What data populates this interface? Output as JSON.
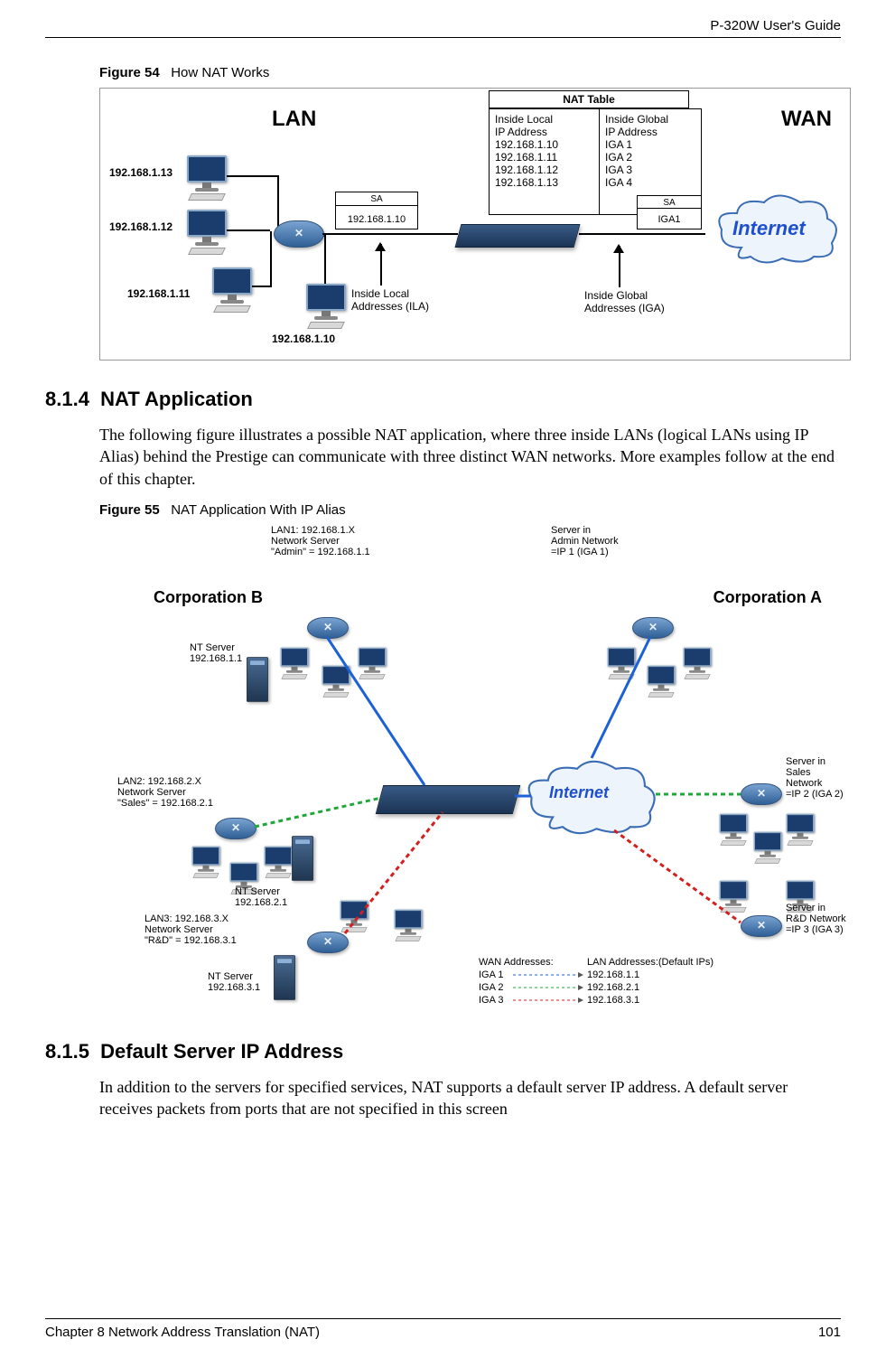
{
  "header": {
    "guide_title": "P-320W User's Guide"
  },
  "figure54": {
    "caption_label": "Figure 54",
    "caption_text": "How NAT Works",
    "lan_label": "LAN",
    "wan_label": "WAN",
    "internet_label": "Internet",
    "nat_table_title": "NAT Table",
    "col_local_header": "Inside Local\nIP Address",
    "col_global_header": "Inside Global\nIP Address",
    "local_ips": [
      "192.168.1.10",
      "192.168.1.11",
      "192.168.1.12",
      "192.168.1.13"
    ],
    "global_ips": [
      "IGA 1",
      "IGA 2",
      "IGA 3",
      "IGA 4"
    ],
    "pc_labels": [
      "192.168.1.13",
      "192.168.1.12",
      "192.168.1.11",
      "192.168.1.10"
    ],
    "env_left_sa": "SA",
    "env_left_addr": "192.168.1.10",
    "env_right_sa": "SA",
    "env_right_addr": "IGA1",
    "ila_label": "Inside Local\nAddresses (ILA)",
    "iga_label": "Inside Global\nAddresses (IGA)"
  },
  "section814": {
    "number": "8.1.4",
    "title": "NAT Application",
    "paragraph": "The following figure illustrates a possible NAT application, where three inside LANs (logical LANs using IP Alias) behind the Prestige can communicate with three distinct WAN networks. More examples follow at the end of this chapter."
  },
  "figure55": {
    "caption_label": "Figure 55",
    "caption_text": "NAT Application With IP Alias",
    "corp_a": "Corporation A",
    "corp_b": "Corporation B",
    "internet_label": "Internet",
    "lan1_text": "LAN1: 192.168.1.X\nNetwork Server\n\"Admin\" = 192.168.1.1",
    "lan2_text": "LAN2: 192.168.2.X\nNetwork Server\n\"Sales\" = 192.168.2.1",
    "lan3_text": "LAN3: 192.168.3.X\nNetwork Server\n\"R&D\" = 192.168.3.1",
    "nt1": "NT Server\n192.168.1.1",
    "nt2": "NT Server\n192.168.2.1",
    "nt3": "NT Server\n192.168.3.1",
    "srv_admin": "Server in\nAdmin Network\n=IP 1 (IGA 1)",
    "srv_sales": "Server in\nSales Network\n=IP 2 (IGA 2)",
    "srv_rd": "Server in\nR&D Network\n=IP 3 (IGA 3)",
    "wan_addr_title": "WAN Addresses:",
    "lan_addr_title": "LAN Addresses:(Default IPs)",
    "iga_list": [
      "IGA 1",
      "IGA 2",
      "IGA 3"
    ],
    "lan_default_ips": [
      "192.168.1.1",
      "192.168.2.1",
      "192.168.3.1"
    ]
  },
  "section815": {
    "number": "8.1.5",
    "title": "Default Server IP Address",
    "paragraph": "In addition to the servers for specified services, NAT supports a default server IP address. A default server receives packets from ports that are not specified in this screen"
  },
  "footer": {
    "chapter": "Chapter 8 Network Address Translation (NAT)",
    "page_number": "101"
  }
}
